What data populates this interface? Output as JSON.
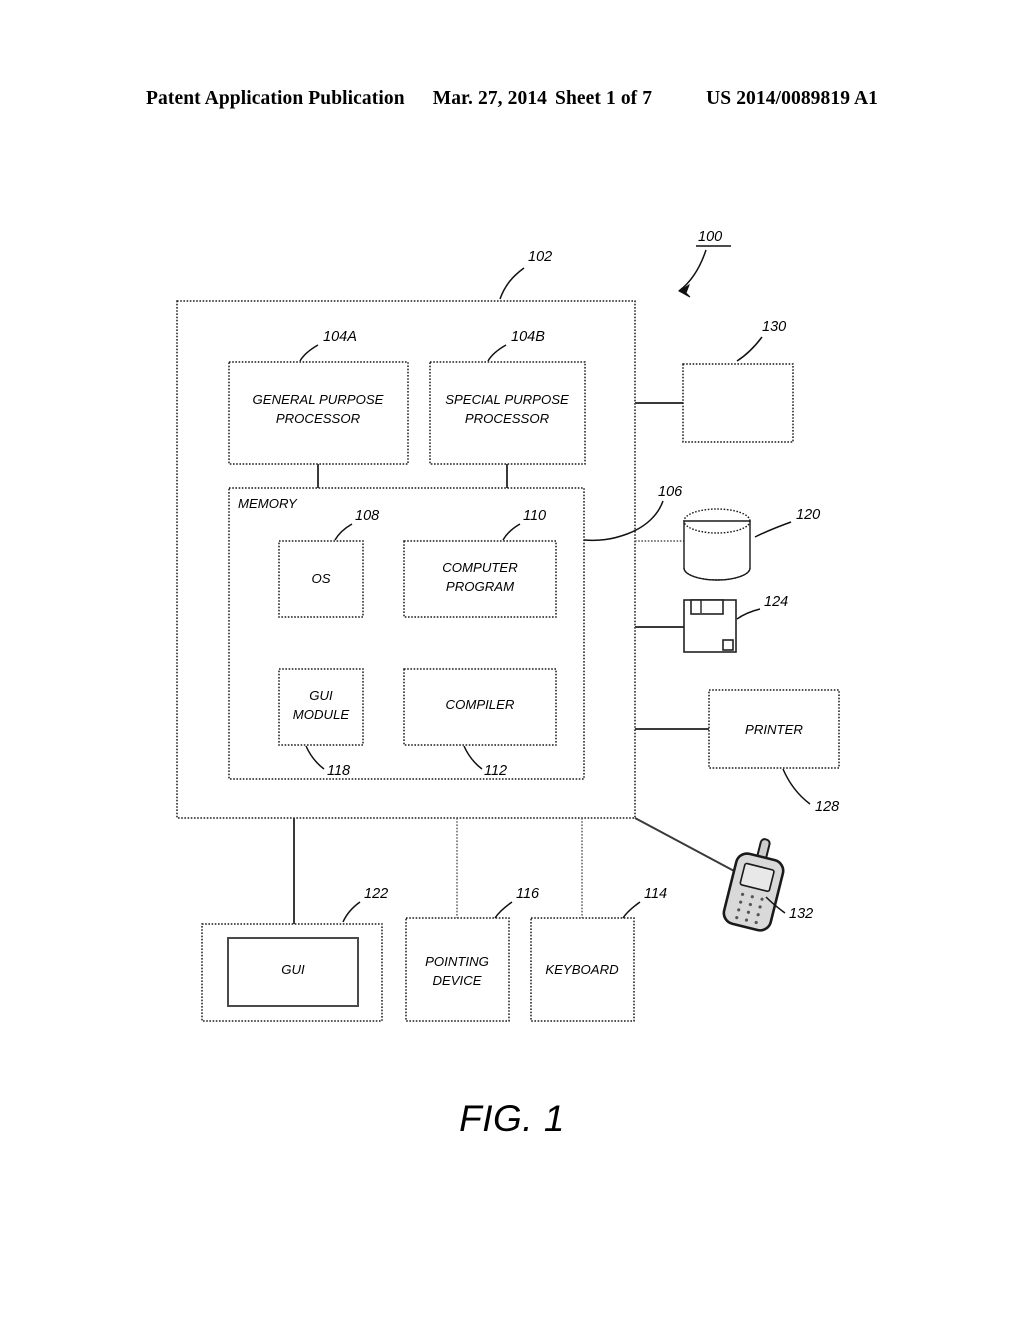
{
  "header": {
    "publication": "Patent Application Publication",
    "date": "Mar. 27, 2014",
    "sheet": "Sheet 1 of 7",
    "patent_number": "US 2014/0089819 A1"
  },
  "figure": {
    "caption": "FIG. 1",
    "system_ref": "100"
  },
  "blocks": {
    "computer": {
      "label": "",
      "ref": "102"
    },
    "general_processor": {
      "label": "GENERAL PURPOSE\nPROCESSOR",
      "line1": "GENERAL PURPOSE",
      "line2": "PROCESSOR",
      "ref": "104A"
    },
    "special_processor": {
      "label": "SPECIAL PURPOSE\nPROCESSOR",
      "line1": "SPECIAL PURPOSE",
      "line2": "PROCESSOR",
      "ref": "104B"
    },
    "memory": {
      "label": "MEMORY",
      "ref": "106"
    },
    "os": {
      "label": "OS",
      "ref": "108"
    },
    "computer_program": {
      "line1": "COMPUTER",
      "line2": "PROGRAM",
      "ref": "110"
    },
    "compiler": {
      "label": "COMPILER",
      "ref": "112"
    },
    "gui_module": {
      "line1": "GUI",
      "line2": "MODULE",
      "ref": "118"
    },
    "unlabeled_device": {
      "label": "",
      "ref": "130"
    },
    "data_storage": {
      "label": "",
      "ref": "120"
    },
    "removable_media": {
      "label": "",
      "ref": "124"
    },
    "printer": {
      "label": "PRINTER",
      "ref": "128"
    },
    "mobile_device": {
      "label": "",
      "ref": "132"
    },
    "gui": {
      "label": "GUI",
      "ref": "122"
    },
    "pointing_device": {
      "line1": "POINTING",
      "line2": "DEVICE",
      "ref": "116"
    },
    "keyboard": {
      "label": "KEYBOARD",
      "ref": "114"
    }
  },
  "icons": {
    "database_cylinder": "database-cylinder-icon",
    "floppy_disk": "floppy-disk-icon",
    "mobile_phone": "mobile-phone-icon",
    "monitor": "monitor-icon",
    "arrow": "curved-arrow-icon"
  },
  "colors": {
    "ink": "#000000",
    "line": "#1a1a1a",
    "page": "#ffffff",
    "phone_fill": "#d9d9d9"
  }
}
